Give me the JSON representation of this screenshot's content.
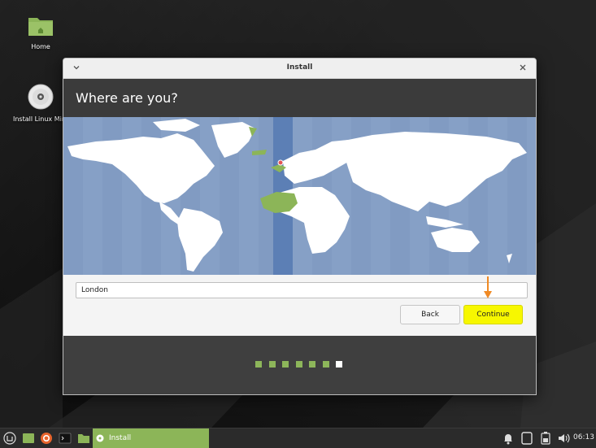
{
  "desktop": {
    "icons": [
      {
        "label": "Home"
      },
      {
        "label": "Install Linux Mint"
      }
    ]
  },
  "window": {
    "title": "Install",
    "heading": "Where are you?",
    "location_value": "London",
    "back_label": "Back",
    "continue_label": "Continue",
    "progress": {
      "total_steps": 7,
      "current_step": 7
    }
  },
  "taskbar": {
    "task_label": "Install",
    "clock": "06:13"
  },
  "colors": {
    "mint_green": "#8cb558",
    "continue_highlight": "#f7f700",
    "map_ocean": "#86a0c6",
    "selected_timezone": "#5c7fb5",
    "arrow": "#f08a24"
  }
}
